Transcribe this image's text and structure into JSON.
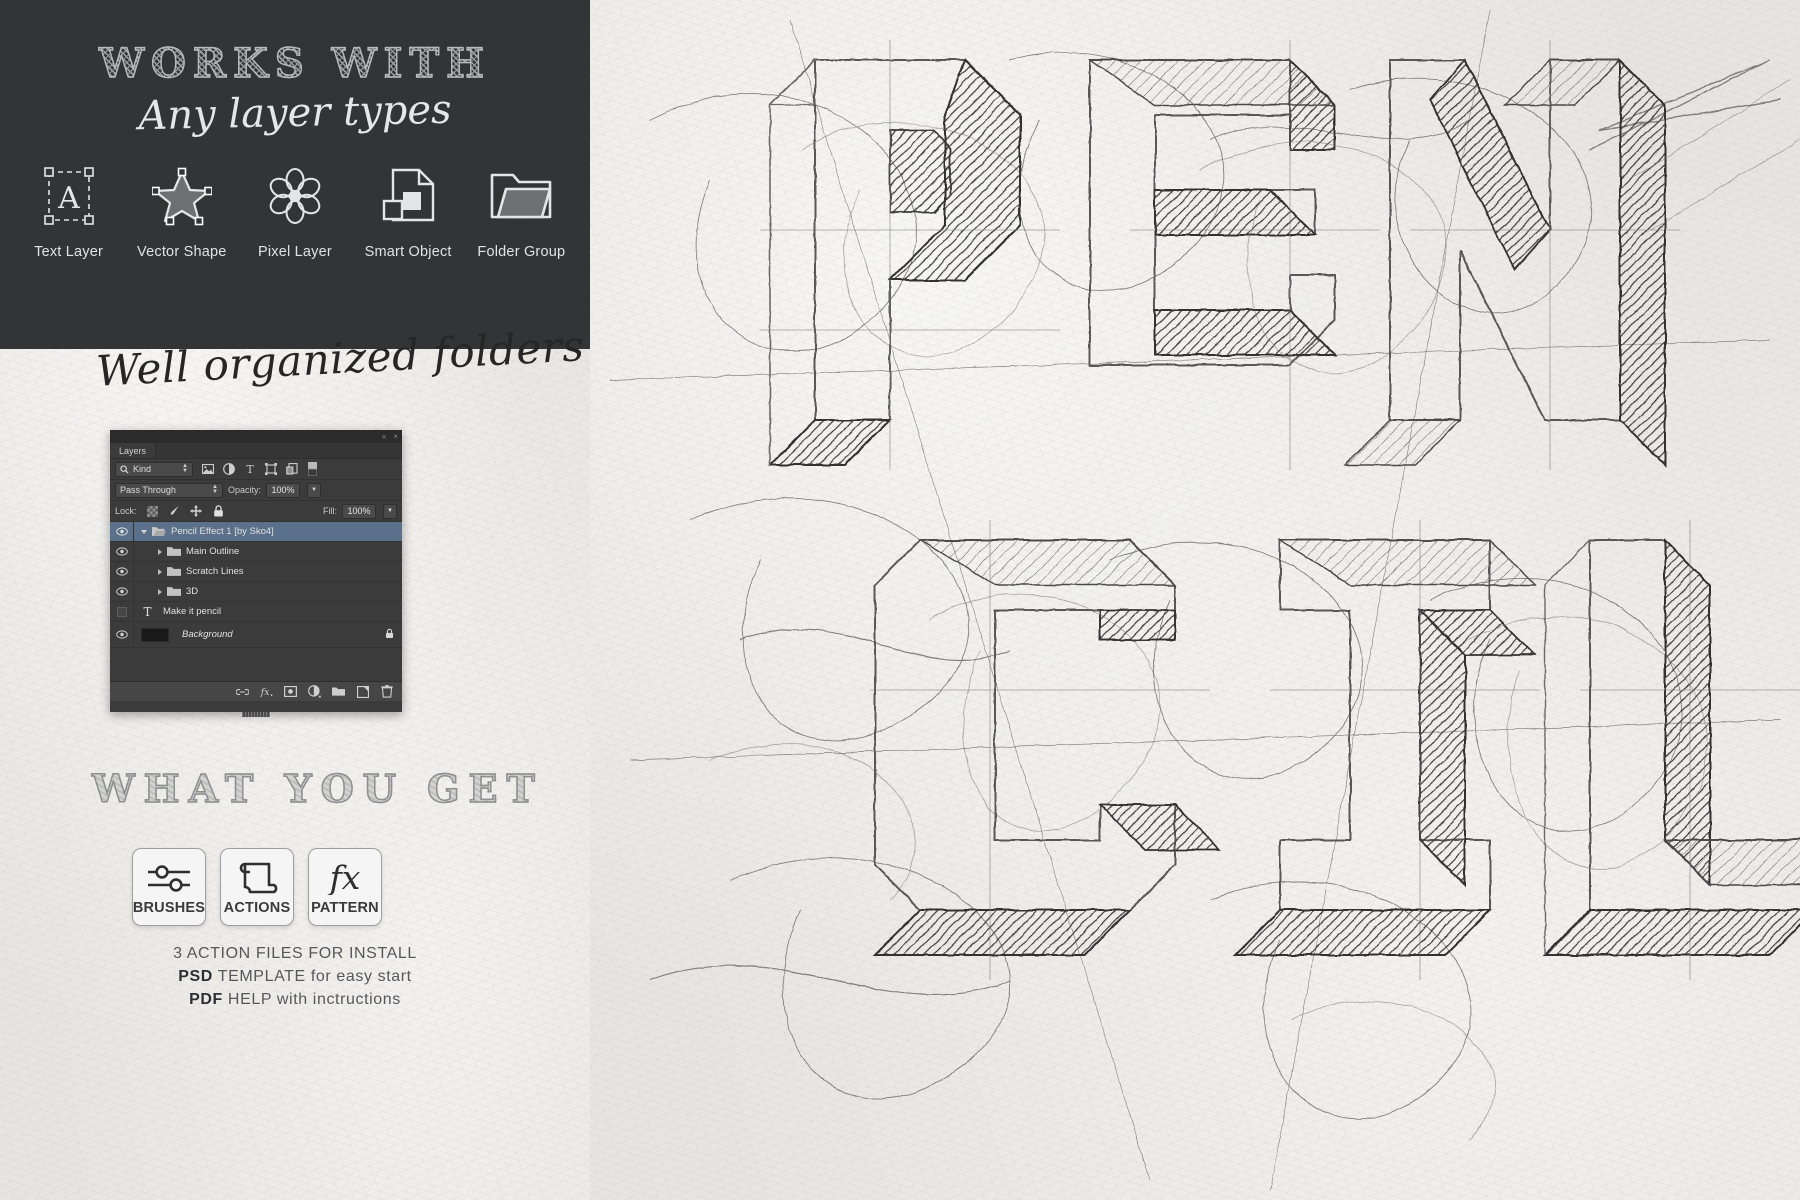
{
  "hero": {
    "title": "WORKS WITH",
    "subtitle": "Any layer types",
    "layer_types": [
      {
        "icon": "text-layer-icon",
        "label": "Text Layer"
      },
      {
        "icon": "vector-shape-icon",
        "label": "Vector Shape"
      },
      {
        "icon": "pixel-layer-icon",
        "label": "Pixel Layer"
      },
      {
        "icon": "smart-object-icon",
        "label": "Smart Object"
      },
      {
        "icon": "folder-group-icon",
        "label": "Folder Group"
      }
    ]
  },
  "sections": {
    "folders_heading": "Well organized folders",
    "what_you_get_heading": "WHAT YOU GET"
  },
  "layers_panel": {
    "titlebar": {
      "collapse": "«",
      "close": "×"
    },
    "tab_label": "Layers",
    "filter": {
      "kind_label": "Kind",
      "search_icon": "search-icon",
      "filter_icons": [
        "pixel-filter-icon",
        "adjustment-filter-icon",
        "type-filter-icon",
        "shape-filter-icon",
        "smart-object-filter-icon",
        "filter-toggle-switch"
      ]
    },
    "blend_mode": "Pass Through",
    "opacity_label": "Opacity:",
    "opacity_value": "100%",
    "lock_label": "Lock:",
    "lock_icons": [
      "lock-transparent-pixels-icon",
      "lock-image-pixels-icon",
      "lock-position-icon",
      "lock-all-icon"
    ],
    "fill_label": "Fill:",
    "fill_value": "100%",
    "rows": [
      {
        "name": "Pencil Effect 1 [by Sko4]",
        "type": "group",
        "visible": true,
        "expanded": true,
        "selected": true,
        "indent": 0
      },
      {
        "name": "Main Outline",
        "type": "group",
        "visible": true,
        "expanded": false,
        "selected": false,
        "indent": 1
      },
      {
        "name": "Scratch Lines",
        "type": "group",
        "visible": true,
        "expanded": false,
        "selected": false,
        "indent": 1
      },
      {
        "name": "3D",
        "type": "group",
        "visible": true,
        "expanded": false,
        "selected": false,
        "indent": 1
      },
      {
        "name": "Make it pencil",
        "type": "text",
        "visible": false,
        "expanded": false,
        "selected": false,
        "indent": 0
      },
      {
        "name": "Background",
        "type": "background",
        "visible": true,
        "expanded": false,
        "selected": false,
        "indent": 0,
        "locked": true
      }
    ],
    "bottom_icons": [
      "link-layers-icon",
      "layer-style-fx-icon",
      "add-layer-mask-icon",
      "new-adjustment-layer-icon",
      "new-group-icon",
      "new-layer-icon",
      "delete-layer-icon"
    ]
  },
  "what_you_get": {
    "badges": [
      {
        "icon": "brushes-sliders-icon",
        "label": "BRUSHES"
      },
      {
        "icon": "actions-scroll-icon",
        "label": "ACTIONS"
      },
      {
        "icon": "pattern-fx-icon",
        "label": "PATTERN"
      }
    ],
    "lines": [
      {
        "strong": "",
        "rest": "3 ACTION FILES FOR INSTALL"
      },
      {
        "strong": "PSD",
        "rest": " TEMPLATE for easy start"
      },
      {
        "strong": "PDF",
        "rest": " HELP with inctructions"
      }
    ]
  },
  "artwork": {
    "word": "PENCIL",
    "line1": "PEN",
    "line2": "CIL",
    "style": "pencil sketch hatched 3D block letters on paper texture"
  },
  "colors": {
    "hero_bg": "#323335",
    "paper_bg": "#e9e7e2",
    "panel_bg": "#3b3b3b",
    "panel_selected": "#5b708a",
    "ink": "#2b2b2b",
    "muted_text": "#55585b"
  }
}
